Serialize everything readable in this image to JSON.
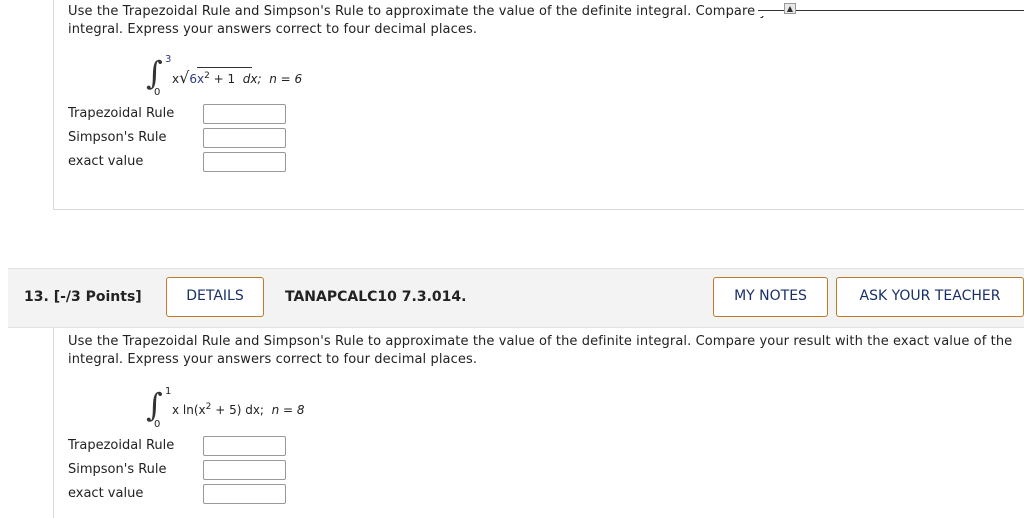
{
  "q12": {
    "prompt_line1": "Use the Trapezoidal Rule and Simpson's Rule to approximate the value of the definite integral. Compare your result with the exact value of the",
    "prompt_line2": "integral. Express your answers correct to four decimal places.",
    "upper": "3",
    "lower": "0",
    "integrand_x": "x",
    "radicand": "6x",
    "radicand_exp": "2",
    "radicand_rest": "+ 1",
    "dx": "dx;",
    "n_label": "n = 6",
    "labels": [
      "Trapezoidal Rule",
      "Simpson's Rule",
      "exact value"
    ]
  },
  "q13": {
    "number": "13.",
    "points": "[-/3 Points]",
    "details_label": "DETAILS",
    "code": "TANAPCALC10 7.3.014.",
    "my_notes_label": "MY NOTES",
    "ask_teacher_label": "ASK YOUR TEACHER",
    "prompt": "Use the Trapezoidal Rule and Simpson's Rule to approximate the value of the definite integral. Compare your result with the exact value of the integral. Express your answers correct to four decimal places.",
    "upper": "1",
    "lower": "0",
    "integrand_pre": "x ln(x",
    "integrand_exp": "2",
    "integrand_post": "+ 5) dx;",
    "n_label": "n = 8",
    "labels": [
      "Trapezoidal Rule",
      "Simpson's Rule",
      "exact value"
    ]
  },
  "icons": {
    "scroll_up": "scroll-up-arrow-icon"
  },
  "colors": {
    "button_border": "#c07a2a",
    "button_text": "#1a2f6a",
    "limit_blue": "#2a3a8a"
  }
}
